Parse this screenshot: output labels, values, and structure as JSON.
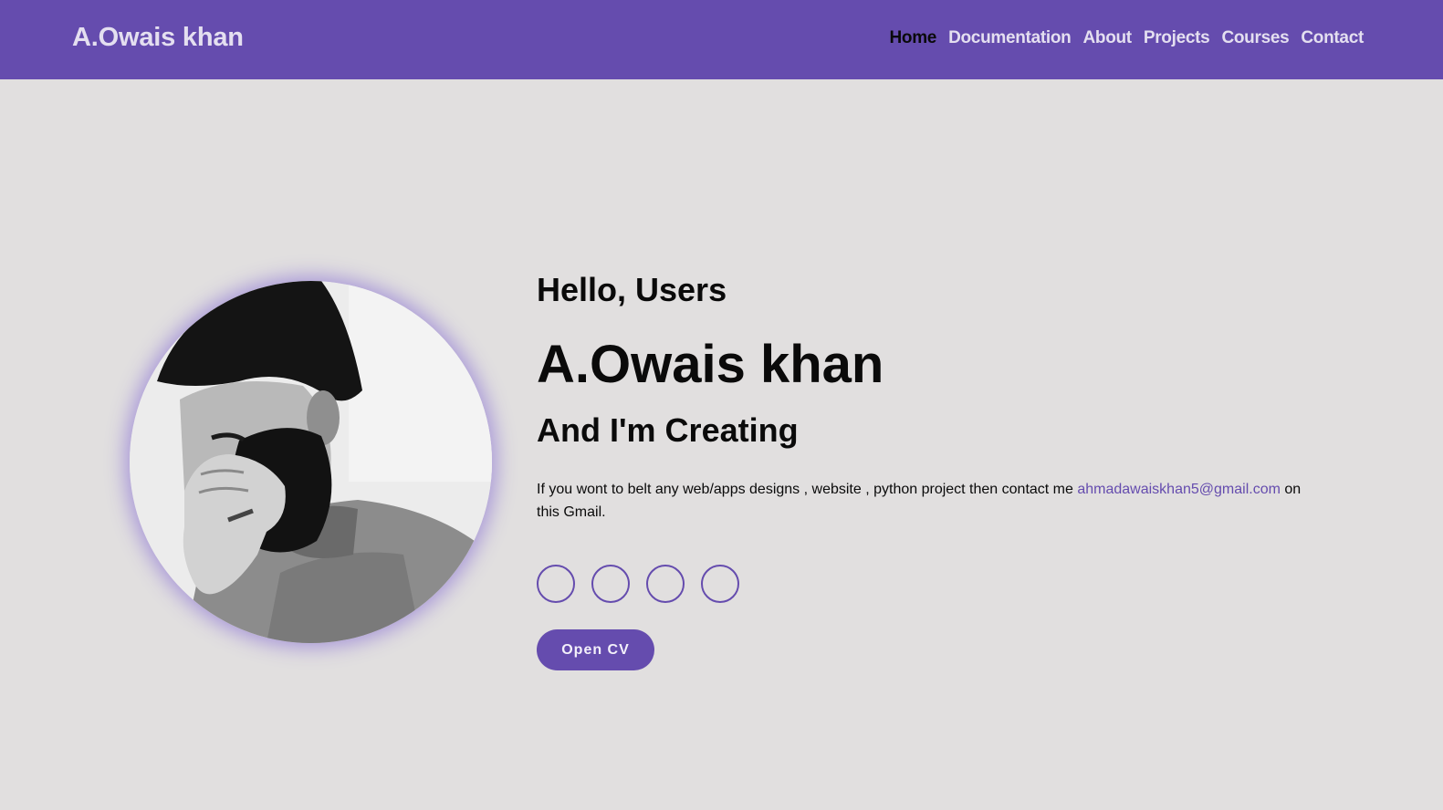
{
  "navbar": {
    "brand": "A.Owais khan",
    "links": [
      {
        "label": "Home",
        "active": true
      },
      {
        "label": "Documentation",
        "active": false
      },
      {
        "label": "About",
        "active": false
      },
      {
        "label": "Projects",
        "active": false
      },
      {
        "label": "Courses",
        "active": false
      },
      {
        "label": "Contact",
        "active": false
      }
    ]
  },
  "hero": {
    "greeting": "Hello, Users",
    "name": "A.Owais khan",
    "tagline": "And I'm Creating",
    "description_before": "If you wont to belt any web/apps designs , website , python project then contact me ",
    "email": "ahmadawaiskhan5@gmail.com",
    "description_after": " on this Gmail.",
    "cv_button": "Open CV"
  },
  "social_icons": [
    "social-link-1",
    "social-link-2",
    "social-link-3",
    "social-link-4"
  ],
  "colors": {
    "accent": "#654cae",
    "background": "#e1dfdf",
    "nav_text": "#e4dff0",
    "active_nav": "#0a0a0a"
  }
}
